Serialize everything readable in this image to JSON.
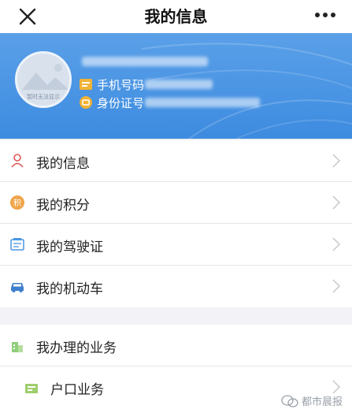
{
  "topbar": {
    "title": "我的信息",
    "close_icon": "close-icon",
    "more_icon": "more-icon"
  },
  "profile": {
    "phone_label": "手机号码",
    "id_label": "身份证号",
    "avatar_caption": "暂时无法显示",
    "colors": {
      "header": "#4a95e4",
      "badge": "#f2b233"
    }
  },
  "menu": [
    {
      "label": "我的信息",
      "icon": "user-icon"
    },
    {
      "label": "我的积分",
      "icon": "points-icon"
    },
    {
      "label": "我的驾驶证",
      "icon": "license-icon"
    },
    {
      "label": "我的机动车",
      "icon": "car-icon"
    }
  ],
  "services": {
    "header_label": "我办理的业务",
    "header_icon": "building-icon",
    "item_label": "户口业务",
    "item_icon": "household-icon"
  },
  "watermark": "都市晨报"
}
